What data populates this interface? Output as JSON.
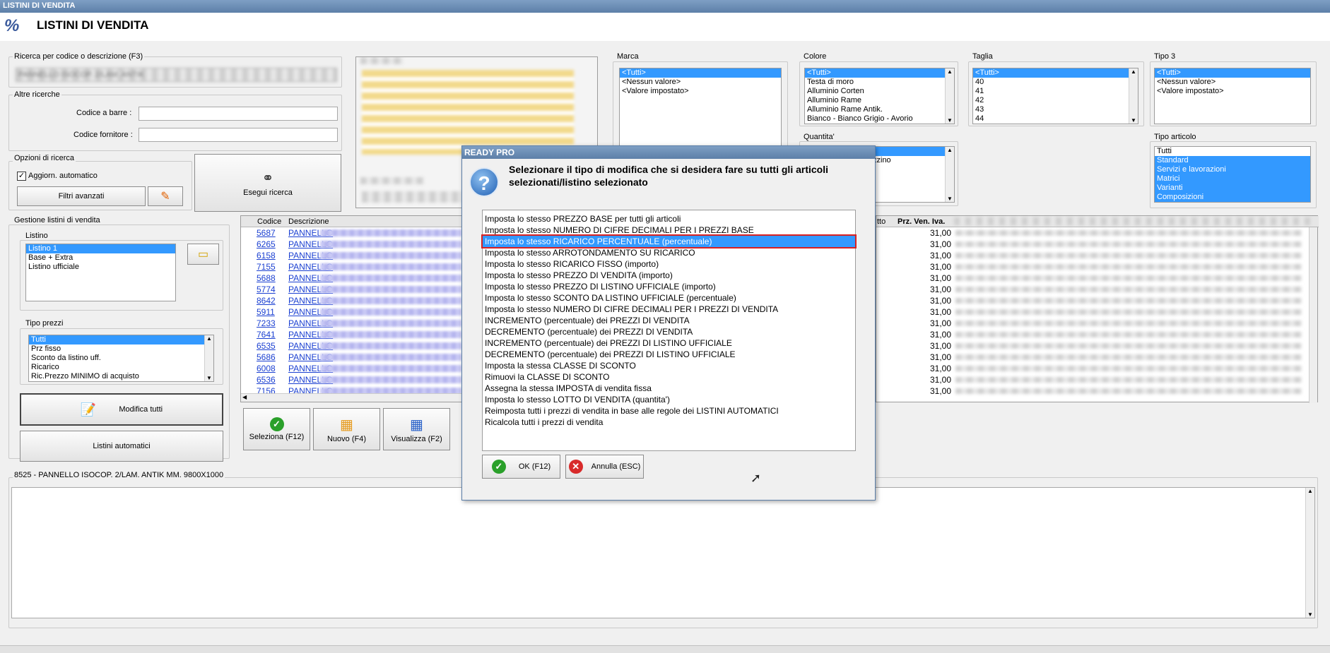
{
  "window": {
    "title": "LISTINI DI VENDITA",
    "header": "LISTINI DI VENDITA",
    "logo": "%"
  },
  "search": {
    "legend": "Ricerca per codice o descrizione (F3)",
    "value": "PANNELLO ISOCOP. 2/LAM. ANTIK"
  },
  "other": {
    "legend": "Altre ricerche",
    "barcode_label": "Codice a barre :",
    "supplier_label": "Codice fornitore :"
  },
  "options": {
    "legend": "Opzioni di ricerca",
    "auto_update": "Aggiorn. automatico",
    "advanced": "Filtri avanzati",
    "search_btn": "Esegui ricerca"
  },
  "gestione": {
    "legend": "Gestione listini di vendita",
    "listino_legend": "Listino",
    "listini": [
      "Listino 1",
      "Base + Extra",
      "Listino ufficiale"
    ],
    "tipo_legend": "Tipo prezzi",
    "tipi": [
      "Tutti",
      "Prz fisso",
      "Sconto da listino uff.",
      "Ricarico",
      "Ric.Prezzo MINIMO di acquisto"
    ],
    "modifica": "Modifica tutti",
    "automatici": "Listini automatici"
  },
  "filters": {
    "marca": {
      "legend": "Marca",
      "items": [
        "<Tutti>",
        "<Nessun valore>",
        "<Valore impostato>"
      ]
    },
    "colore": {
      "legend": "Colore",
      "items": [
        "<Tutti>",
        "Testa di moro",
        "Alluminio Corten",
        "Alluminio Rame",
        "Alluminio Rame Antik.",
        "Bianco - Bianco Grigio - Avorio"
      ]
    },
    "taglia": {
      "legend": "Taglia",
      "items": [
        "<Tutti>",
        "40",
        "41",
        "42",
        "43",
        "44"
      ]
    },
    "tipo3": {
      "legend": "Tipo 3",
      "items": [
        "<Tutti>",
        "<Nessun valore>",
        "<Valore impostato>"
      ]
    },
    "quantita": {
      "legend": "Quantita'",
      "items": [
        "",
        "zzino"
      ]
    },
    "tipo_articolo": {
      "legend": "Tipo articolo",
      "items": [
        "Tutti",
        "Standard",
        "Servizi e lavorazioni",
        "Matrici",
        "Varianti",
        "Composizioni"
      ]
    }
  },
  "grid": {
    "headers": {
      "codice": "Codice",
      "descrizione": "Descrizione",
      "tto": "tto",
      "prezzo": "Prz. Ven. Iva."
    },
    "rows": [
      {
        "codice": "5687",
        "desc": "PANNELLO",
        "prezzo": "31,00"
      },
      {
        "codice": "6265",
        "desc": "PANNELLO",
        "prezzo": "31,00"
      },
      {
        "codice": "6158",
        "desc": "PANNELLO",
        "prezzo": "31,00"
      },
      {
        "codice": "7155",
        "desc": "PANNELLO",
        "prezzo": "31,00"
      },
      {
        "codice": "5688",
        "desc": "PANNELLO",
        "prezzo": "31,00"
      },
      {
        "codice": "5774",
        "desc": "PANNELLO",
        "prezzo": "31,00"
      },
      {
        "codice": "8642",
        "desc": "PANNELLO",
        "prezzo": "31,00"
      },
      {
        "codice": "5911",
        "desc": "PANNELLO",
        "prezzo": "31,00"
      },
      {
        "codice": "7233",
        "desc": "PANNELLO",
        "prezzo": "31,00"
      },
      {
        "codice": "7641",
        "desc": "PANNELLO",
        "prezzo": "31,00"
      },
      {
        "codice": "6535",
        "desc": "PANNELLO",
        "prezzo": "31,00"
      },
      {
        "codice": "5686",
        "desc": "PANNELLO",
        "prezzo": "31,00"
      },
      {
        "codice": "6008",
        "desc": "PANNELLO",
        "prezzo": "31,00"
      },
      {
        "codice": "6536",
        "desc": "PANNELLO",
        "prezzo": "31,00"
      },
      {
        "codice": "7156",
        "desc": "PANNELLO",
        "prezzo": "31,00"
      }
    ]
  },
  "toolbar": {
    "seleziona": "Seleziona (F12)",
    "nuovo": "Nuovo (F4)",
    "visualizza": "Visualizza (F2)"
  },
  "detail": {
    "legend": "8525 - PANNELLO ISOCOP. 2/LAM. ANTIK MM. 9800X1000"
  },
  "dialog": {
    "caption": "READY PRO",
    "question": "Selezionare il tipo di modifica che si desidera fare su tutti gli articoli selezionati/listino selezionato",
    "options": [
      "Imposta lo stesso PREZZO BASE per tutti gli articoli",
      "Imposta lo stesso NUMERO DI CIFRE DECIMALI PER I PREZZI BASE",
      "Imposta lo stesso RICARICO PERCENTUALE (percentuale)",
      "Imposta lo stesso ARROTONDAMENTO SU RICARICO",
      "Imposta lo stesso RICARICO FISSO (importo)",
      "Imposta lo stesso PREZZO DI VENDITA (importo)",
      "Imposta lo stesso PREZZO DI LISTINO UFFICIALE (importo)",
      "Imposta lo stesso SCONTO DA LISTINO UFFICIALE (percentuale)",
      "Imposta lo stesso NUMERO DI CIFRE DECIMALI PER I PREZZI DI VENDITA",
      "INCREMENTO (percentuale) dei PREZZI DI VENDITA",
      "DECREMENTO (percentuale) dei PREZZI DI VENDITA",
      "INCREMENTO (percentuale) dei PREZZI DI LISTINO UFFICIALE",
      "DECREMENTO (percentuale) dei PREZZI DI LISTINO UFFICIALE",
      "Imposta la stessa CLASSE DI SCONTO",
      "Rimuovi la CLASSE DI SCONTO",
      "Assegna la stessa IMPOSTA di vendita fissa",
      "Imposta lo stesso LOTTO DI VENDITA (quantita')",
      "Reimposta tutti i prezzi di vendita in base alle regole dei LISTINI AUTOMATICI",
      "Ricalcola tutti i prezzi di vendita"
    ],
    "ok": "OK (F12)",
    "cancel": "Annulla (ESC)"
  }
}
